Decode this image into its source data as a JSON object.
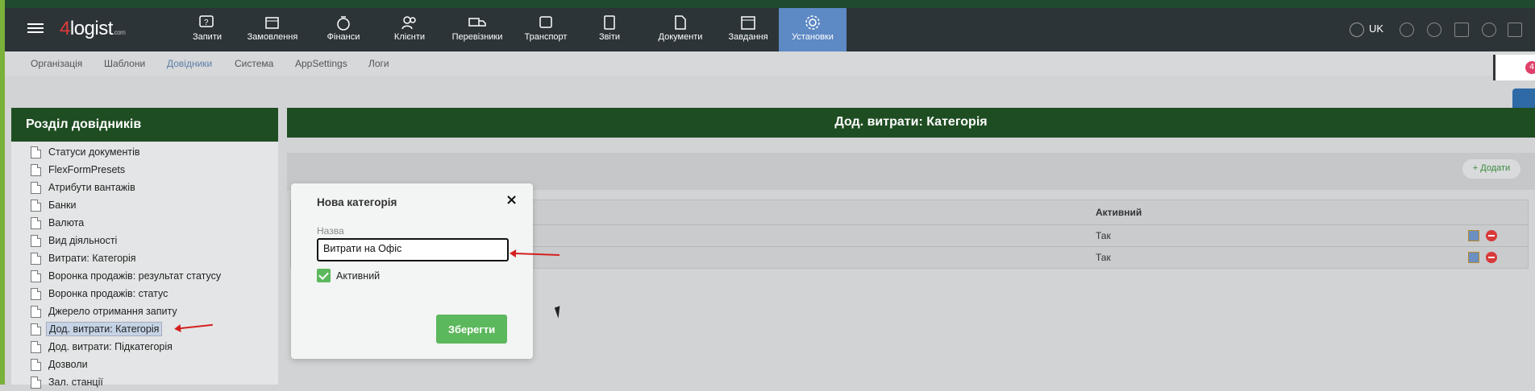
{
  "app": {
    "logo_main": "4logist",
    "logo_suffix": ".com"
  },
  "topnav": {
    "items": [
      {
        "label": "Запити",
        "icon": "question-icon"
      },
      {
        "label": "Замовлення",
        "icon": "box-icon"
      },
      {
        "label": "Фінанси",
        "icon": "money-bag-icon"
      },
      {
        "label": "Клієнти",
        "icon": "users-icon"
      },
      {
        "label": "Перевізники",
        "icon": "truck-icon"
      },
      {
        "label": "Транспорт",
        "icon": "vehicle-icon"
      },
      {
        "label": "Звіти",
        "icon": "calculator-icon"
      },
      {
        "label": "Документи",
        "icon": "document-icon"
      },
      {
        "label": "Завдання",
        "icon": "calendar-icon"
      },
      {
        "label": "Установки",
        "icon": "gear-icon"
      }
    ],
    "language": "UK"
  },
  "subnav": [
    "Організація",
    "Шаблони",
    "Довідники",
    "Система",
    "AppSettings",
    "Логи"
  ],
  "sidebar": {
    "title": "Розділ довідників",
    "items": [
      "Статуси документів",
      "FlexFormPresets",
      "Атрибути вантажів",
      "Банки",
      "Валюта",
      "Вид діяльності",
      "Витрати: Категорія",
      "Воронка продажів: результат статусу",
      "Воронка продажів: статус",
      "Джерело отримання запиту",
      "Дод. витрати: Категорія",
      "Дод. витрати: Підкатегорія",
      "Дозволи",
      "Зал. станції"
    ]
  },
  "main": {
    "title": "Дод. витрати: Категорія",
    "add_label": "Додати",
    "column_active": "Активний",
    "rows": [
      "Так",
      "Так"
    ]
  },
  "modal": {
    "title": "Нова категорія",
    "close": "×",
    "name_label": "Назва",
    "name_value": "Витрати на Офіс",
    "active_label": "Активний",
    "save_label": "Зберегти"
  },
  "notification_badge": "4",
  "colors": {
    "header_green": "#1f4d22",
    "active_nav": "#5d89c4",
    "save_green": "#5cb85c"
  }
}
